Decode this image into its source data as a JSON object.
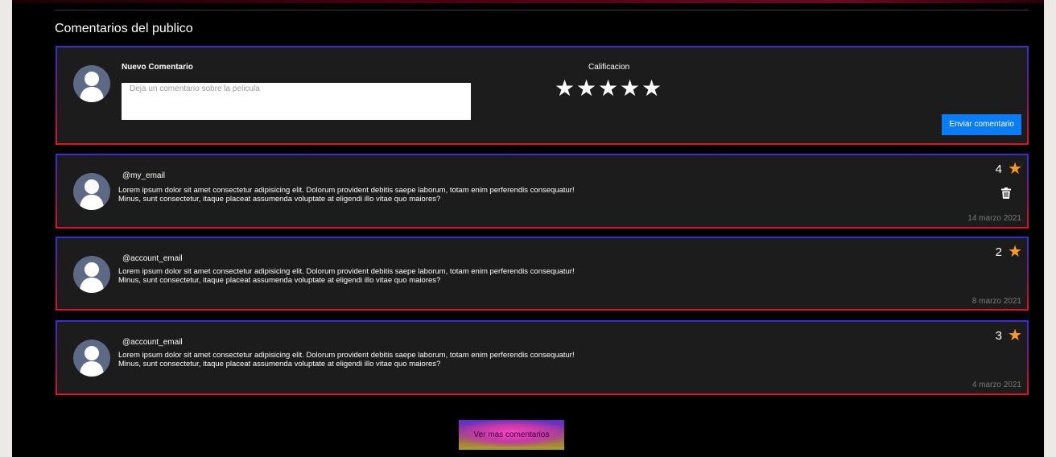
{
  "section": {
    "title": "Comentarios del publico"
  },
  "new_comment": {
    "label": "Nuevo Comentario",
    "placeholder": "Deja un comentario sobre la pelicula",
    "value": "",
    "rating_label": "Calificacion",
    "stars": [
      "★",
      "★",
      "★",
      "★",
      "★"
    ],
    "submit_label": "Enviar comentario"
  },
  "comments": [
    {
      "user": "@my_email",
      "text_line1": "Lorem ipsum dolor sit amet consectetur adipisicing elit. Dolorum provident debitis saepe laborum, totam enim perferendis consequatur!",
      "text_line2": "Minus, sunt consectetur, itaque placeat assumenda voluptate at eligendi illo vitae quo maiores?",
      "rating": "4",
      "date": "14 marzo 2021",
      "deletable": true
    },
    {
      "user": "@account_email",
      "text_line1": "Lorem ipsum dolor sit amet consectetur adipisicing elit. Dolorum provident debitis saepe laborum, totam enim perferendis consequatur!",
      "text_line2": "Minus, sunt consectetur, itaque placeat assumenda voluptate at eligendi illo vitae quo maiores?",
      "rating": "2",
      "date": "8 marzo 2021",
      "deletable": false
    },
    {
      "user": "@account_email",
      "text_line1": "Lorem ipsum dolor sit amet consectetur adipisicing elit. Dolorum provident debitis saepe laborum, totam enim perferendis consequatur!",
      "text_line2": "Minus, sunt consectetur, itaque placeat assumenda voluptate at eligendi illo vitae quo maiores?",
      "rating": "3",
      "date": "4 marzo 2021",
      "deletable": false
    }
  ],
  "rating_star_glyph": "★",
  "load_more_label": "Ver mas comentarios",
  "colors": {
    "background": "#000000",
    "card": "#1c1c1c",
    "border_top": "#3b2bd8",
    "border_bottom": "#e0102a",
    "submit_button": "#0a7cf5",
    "star_accent": "#ff9a1a",
    "date_text": "#7a7a7a"
  },
  "icons": [
    "user-avatar-icon",
    "star-icon",
    "trash-icon"
  ]
}
